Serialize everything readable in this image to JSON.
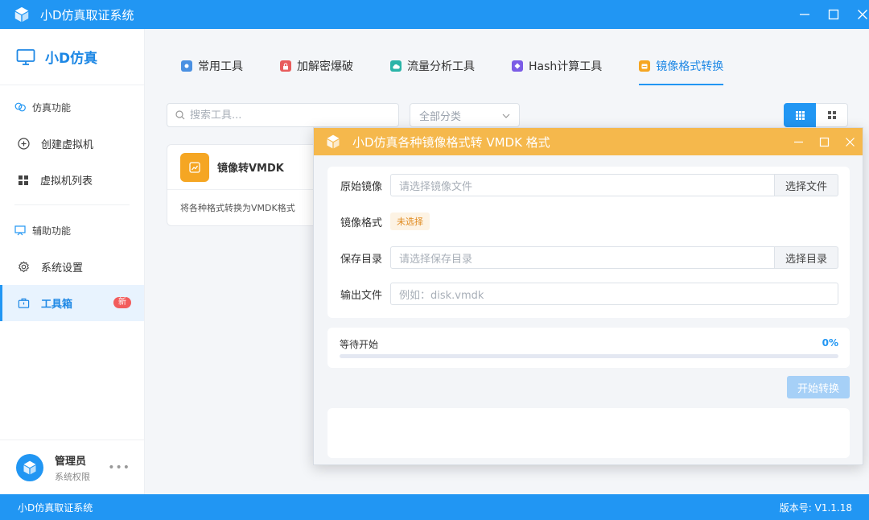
{
  "window": {
    "title": "小D仿真取证系统"
  },
  "sidebar": {
    "brand": "小D仿真",
    "sections": [
      {
        "title": "仿真功能",
        "items": [
          {
            "label": "创建虚拟机"
          },
          {
            "label": "虚拟机列表"
          }
        ]
      },
      {
        "title": "辅助功能",
        "items": [
          {
            "label": "系统设置"
          },
          {
            "label": "工具箱",
            "badge": "新",
            "active": true
          }
        ]
      }
    ],
    "user": {
      "name": "管理员",
      "role": "系统权限",
      "more": "•••"
    }
  },
  "tabs": [
    {
      "label": "常用工具",
      "icon": "puzzle-icon",
      "color": "#4a90e2"
    },
    {
      "label": "加解密爆破",
      "icon": "lock-icon",
      "color": "#e85c5c"
    },
    {
      "label": "流量分析工具",
      "icon": "cloud-icon",
      "color": "#2bb4a8"
    },
    {
      "label": "Hash计算工具",
      "icon": "hash-icon",
      "color": "#7b5ce6"
    },
    {
      "label": "镜像格式转换",
      "icon": "image-icon",
      "color": "#f5a623",
      "active": true
    }
  ],
  "toolbar": {
    "search_placeholder": "搜索工具...",
    "category_select": "全部分类"
  },
  "card": {
    "title": "镜像转VMDK",
    "description": "将各种格式转换为VMDK格式"
  },
  "dialog": {
    "title": "小D仿真各种镜像格式转 VMDK 格式",
    "source_label": "原始镜像",
    "source_placeholder": "请选择镜像文件",
    "source_button": "选择文件",
    "format_label": "镜像格式",
    "format_value": "未选择",
    "save_label": "保存目录",
    "save_placeholder": "请选择保存目录",
    "save_button": "选择目录",
    "output_label": "输出文件",
    "output_placeholder": "例如：disk.vmdk",
    "progress_status": "等待开始",
    "progress_percent": "0%",
    "progress_value": 0,
    "start_button": "开始转换"
  },
  "statusbar": {
    "left": "小D仿真取证系统",
    "version": "版本号: V1.1.18"
  },
  "colors": {
    "primary": "#2196f3",
    "dialog_header": "#f5b84c",
    "badge": "#f25c5c"
  }
}
